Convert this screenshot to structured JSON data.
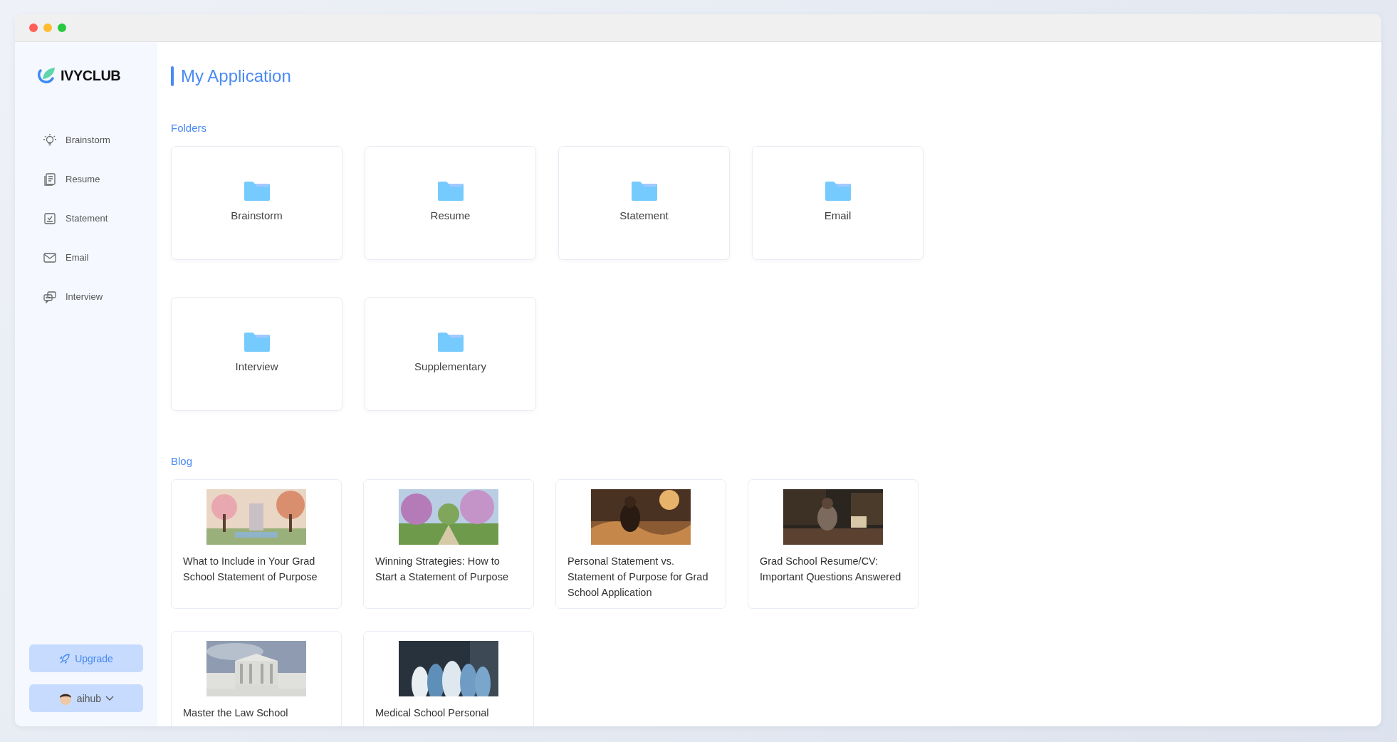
{
  "brand": {
    "name": "IVYCLUB"
  },
  "sidebar": {
    "items": [
      {
        "label": "Brainstorm"
      },
      {
        "label": "Resume"
      },
      {
        "label": "Statement"
      },
      {
        "label": "Email"
      },
      {
        "label": "Interview"
      }
    ],
    "upgrade": {
      "label": "Upgrade"
    },
    "user": {
      "name": "aihub"
    }
  },
  "page": {
    "title": "My Application"
  },
  "folders": {
    "heading": "Folders",
    "items": [
      {
        "label": "Brainstorm"
      },
      {
        "label": "Resume"
      },
      {
        "label": "Statement"
      },
      {
        "label": "Email"
      },
      {
        "label": "Interview"
      },
      {
        "label": "Supplementary"
      }
    ]
  },
  "blog": {
    "heading": "Blog",
    "posts": [
      {
        "title": "What to Include in Your Grad School Statement of Purpose"
      },
      {
        "title": "Winning Strategies: How to Start a Statement of Purpose"
      },
      {
        "title": "Personal Statement vs. Statement of Purpose for Grad School Application"
      },
      {
        "title": "Grad School Resume/CV: Important Questions Answered"
      },
      {
        "title": "Master the Law School"
      },
      {
        "title": "Medical School Personal"
      }
    ]
  }
}
